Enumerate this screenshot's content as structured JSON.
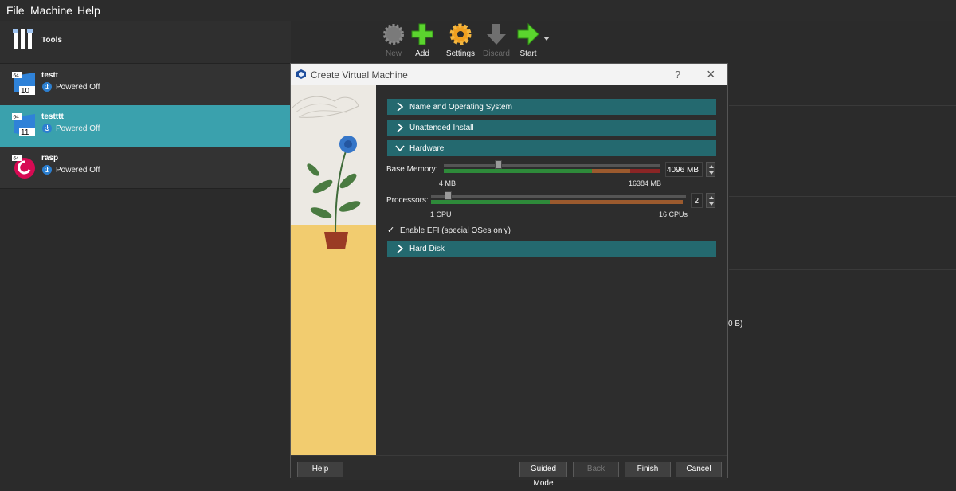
{
  "menu": {
    "file": "File",
    "machine": "Machine",
    "help": "Help"
  },
  "tools": {
    "label": "Tools"
  },
  "toolbar": {
    "new": "New",
    "add": "Add",
    "settings": "Settings",
    "discard": "Discard",
    "start": "Start"
  },
  "vms": [
    {
      "name": "testt",
      "state": "Powered Off",
      "os_badge": "64",
      "os_num": "10"
    },
    {
      "name": "testttt",
      "state": "Powered Off",
      "os_badge": "64",
      "os_num": "11"
    },
    {
      "name": "rasp",
      "state": "Powered Off",
      "os_badge": "64"
    }
  ],
  "right_partial": {
    "text": "0 B)"
  },
  "dialog": {
    "title": "Create Virtual Machine",
    "help_glyph": "?",
    "close_glyph": "×",
    "sections": {
      "name_os": "Name and Operating System",
      "unattended": "Unattended Install",
      "hardware": "Hardware",
      "hard_disk": "Hard Disk"
    },
    "memory": {
      "label": "Base Memory:",
      "value": "4096 MB",
      "min": "4 MB",
      "max": "16384 MB",
      "fraction": 0.25
    },
    "processors": {
      "label": "Processors:",
      "value": "2",
      "min": "1 CPU",
      "max": "16 CPUs",
      "fraction": 0.0667
    },
    "efi": {
      "label": "Enable EFI (special OSes only)",
      "checked": true,
      "check_glyph": "✓"
    },
    "buttons": {
      "help": "Help",
      "guided": "Guided Mode",
      "back": "Back",
      "finish": "Finish",
      "cancel": "Cancel"
    }
  },
  "colors": {
    "accent": "#3aa1ad",
    "section": "#24696f",
    "floor": "#f2cc6f"
  }
}
